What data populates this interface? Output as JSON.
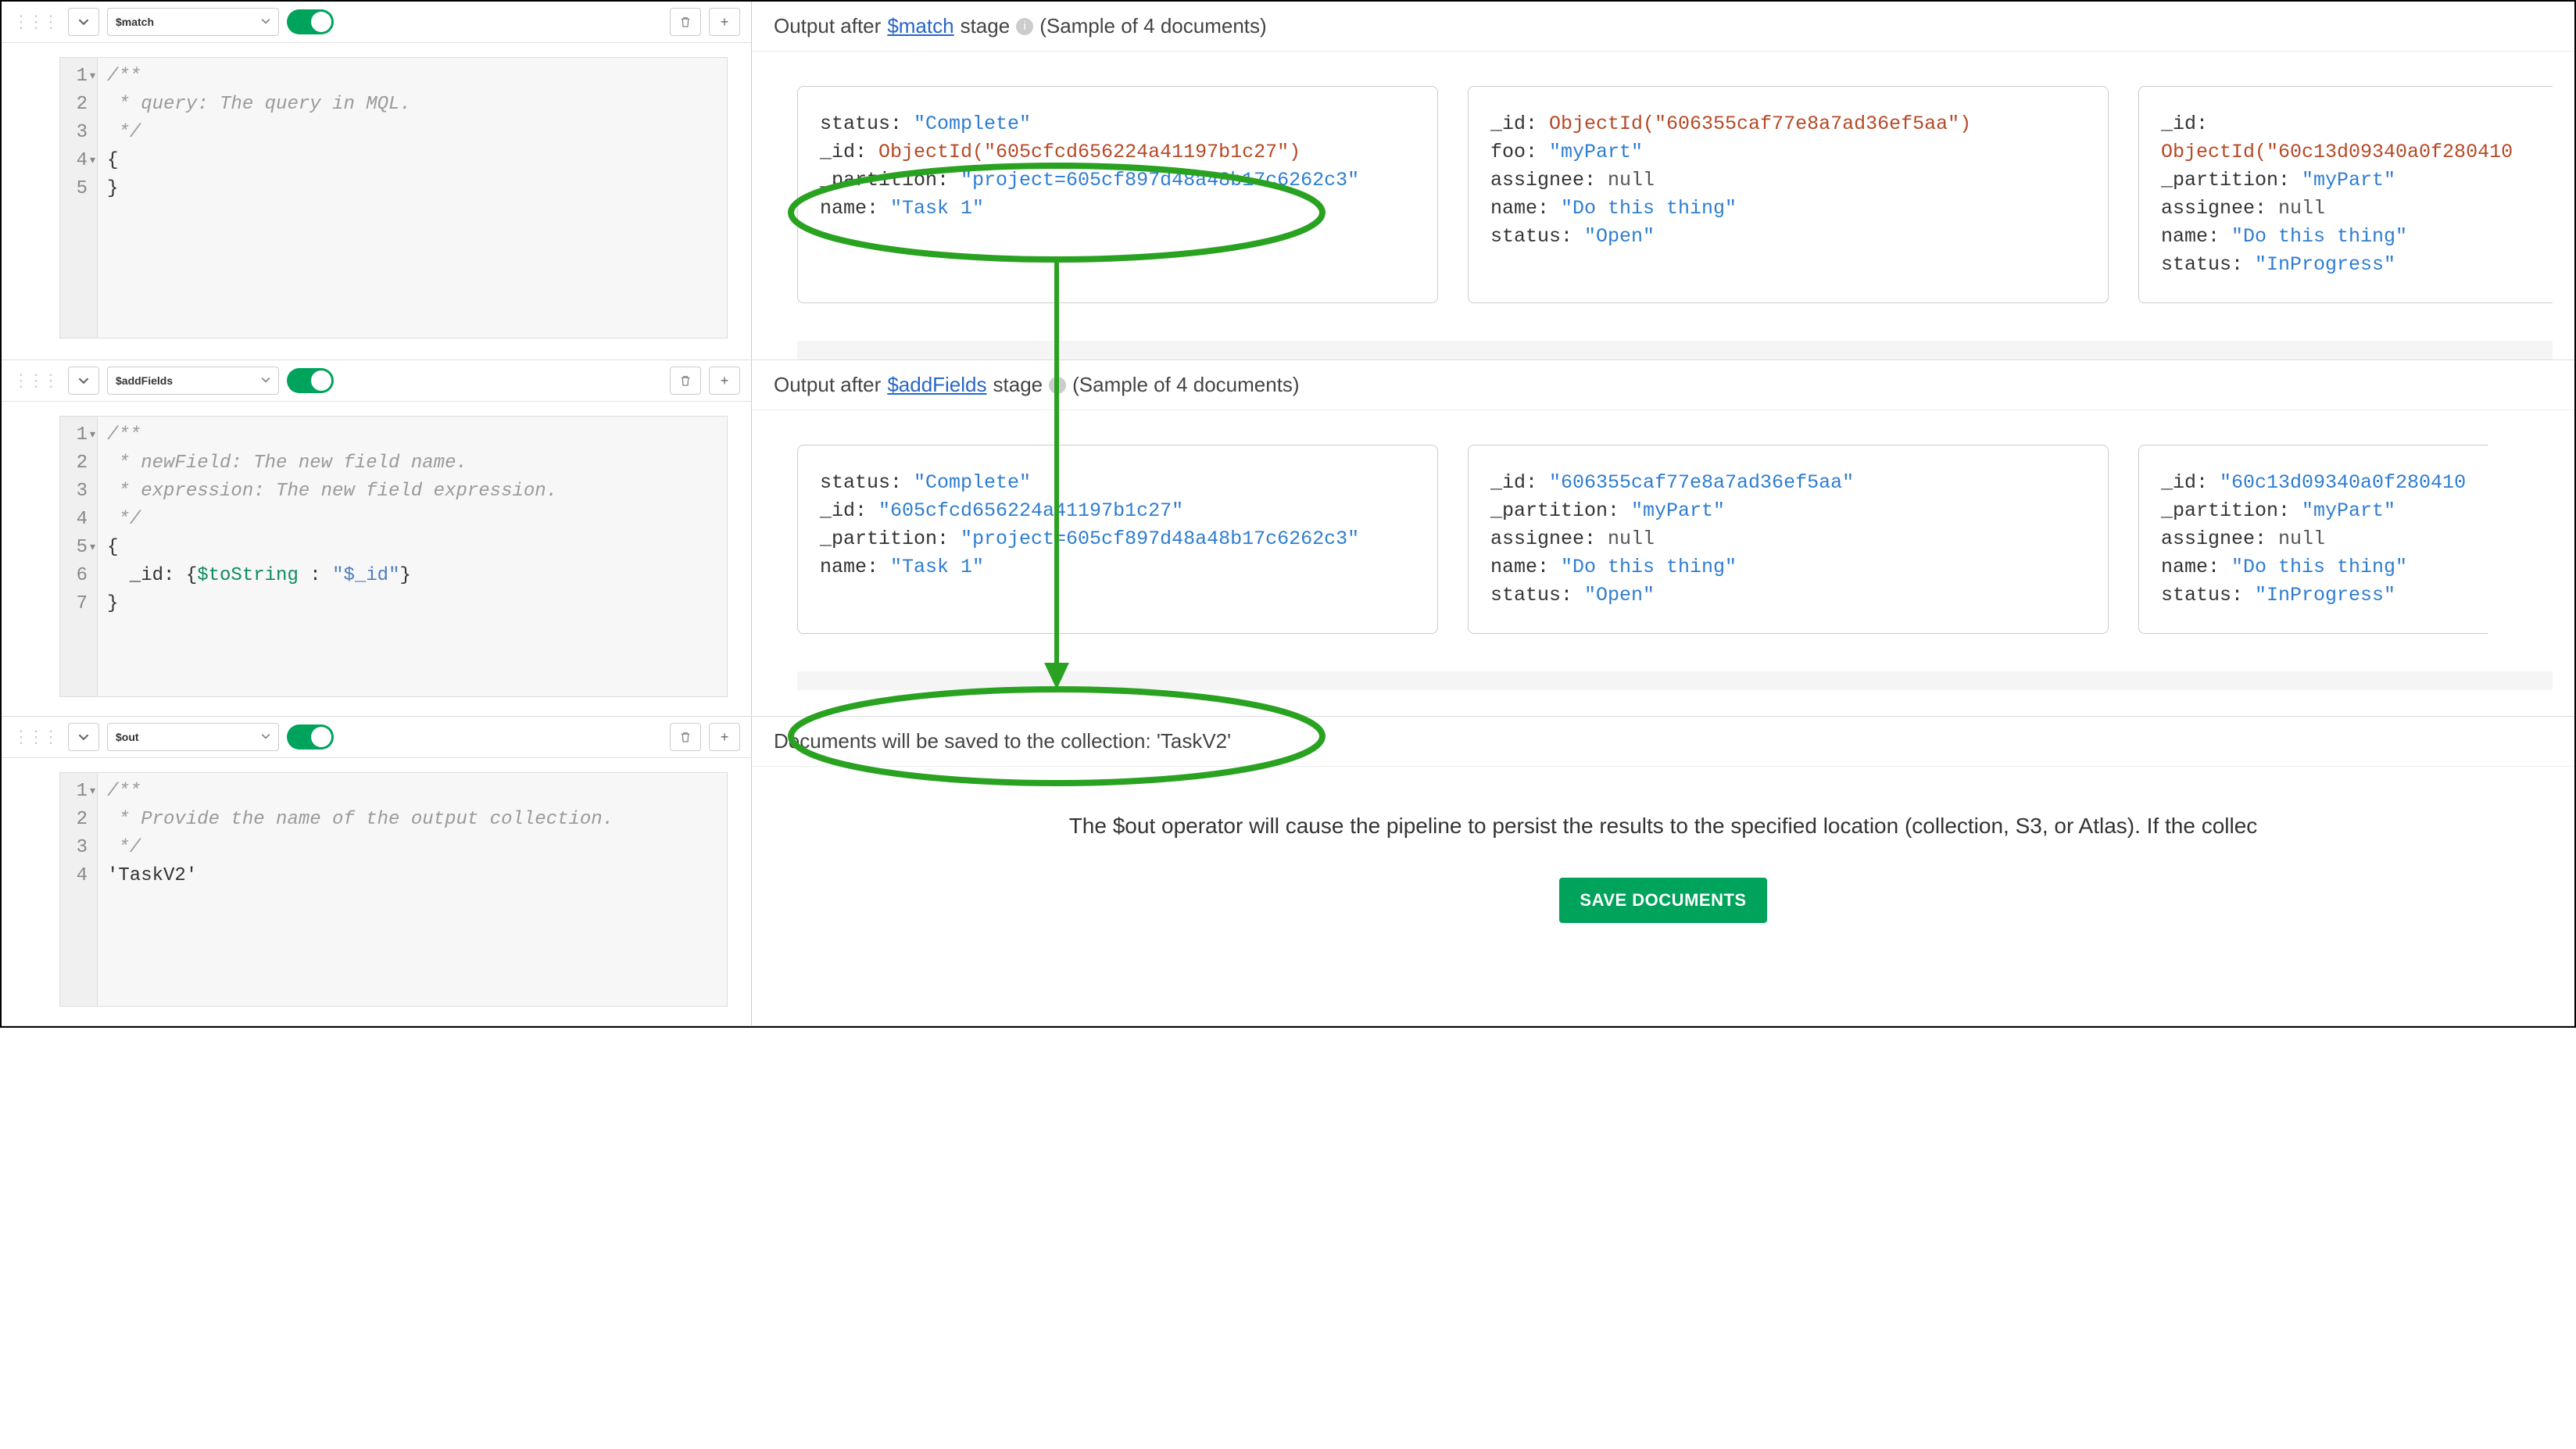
{
  "stages": [
    {
      "name": "$match",
      "code": {
        "lines": [
          {
            "n": "1",
            "fold": true,
            "txt": "/**"
          },
          {
            "n": "2",
            "txt": " * query: The query in MQL."
          },
          {
            "n": "3",
            "txt": " */"
          },
          {
            "n": "4",
            "fold": true,
            "plain": "{"
          },
          {
            "n": "5",
            "plain": "}"
          }
        ]
      },
      "output": {
        "prefix": "Output after ",
        "link": "$match",
        "suffix": " stage",
        "sample": "(Sample of 4 documents)"
      },
      "docs": [
        [
          {
            "k": "status",
            "v": "\"Complete\"",
            "t": "str"
          },
          {
            "k": "_id",
            "v": "ObjectId(\"605cfcd656224a41197b1c27\")",
            "t": "call"
          },
          {
            "k": "_partition",
            "v": "\"project=605cf897d48a48b17c6262c3\"",
            "t": "str"
          },
          {
            "k": "name",
            "v": "\"Task 1\"",
            "t": "str"
          }
        ],
        [
          {
            "k": "_id",
            "v": "ObjectId(\"606355caf77e8a7ad36ef5aa\")",
            "t": "call"
          },
          {
            "k": "foo",
            "v": "\"myPart\"",
            "t": "str"
          },
          {
            "k": "assignee",
            "v": "null",
            "t": "null"
          },
          {
            "k": "name",
            "v": "\"Do this thing\"",
            "t": "str"
          },
          {
            "k": "status",
            "v": "\"Open\"",
            "t": "str"
          }
        ],
        [
          {
            "k": "_id",
            "v": "ObjectId(\"60c13d09340a0f280410",
            "t": "call"
          },
          {
            "k": "_partition",
            "v": "\"myPart\"",
            "t": "str"
          },
          {
            "k": "assignee",
            "v": "null",
            "t": "null"
          },
          {
            "k": "name",
            "v": "\"Do this thing\"",
            "t": "str"
          },
          {
            "k": "status",
            "v": "\"InProgress\"",
            "t": "str"
          }
        ]
      ]
    },
    {
      "name": "$addFields",
      "code": {
        "lines": [
          {
            "n": "1",
            "fold": true,
            "txt": "/**"
          },
          {
            "n": "2",
            "txt": " * newField: The new field name."
          },
          {
            "n": "3",
            "txt": " * expression: The new field expression."
          },
          {
            "n": "4",
            "txt": " */"
          },
          {
            "n": "5",
            "fold": true,
            "plain": "{"
          },
          {
            "n": "6",
            "code": {
              "pre": "  _id: {",
              "op": "$toString",
              "mid": " : ",
              "str": "\"$_id\"",
              "post": "}"
            }
          },
          {
            "n": "7",
            "plain": "}"
          }
        ]
      },
      "output": {
        "prefix": "Output after ",
        "link": "$addFields",
        "suffix": " stage",
        "sample": "(Sample of 4 documents)"
      },
      "docs": [
        [
          {
            "k": "status",
            "v": "\"Complete\"",
            "t": "str"
          },
          {
            "k": "_id",
            "v": "\"605cfcd656224a41197b1c27\"",
            "t": "str"
          },
          {
            "k": "_partition",
            "v": "\"project=605cf897d48a48b17c6262c3\"",
            "t": "str"
          },
          {
            "k": "name",
            "v": "\"Task 1\"",
            "t": "str"
          }
        ],
        [
          {
            "k": "_id",
            "v": "\"606355caf77e8a7ad36ef5aa\"",
            "t": "str"
          },
          {
            "k": "_partition",
            "v": "\"myPart\"",
            "t": "str"
          },
          {
            "k": "assignee",
            "v": "null",
            "t": "null"
          },
          {
            "k": "name",
            "v": "\"Do this thing\"",
            "t": "str"
          },
          {
            "k": "status",
            "v": "\"Open\"",
            "t": "str"
          }
        ],
        [
          {
            "k": "_id",
            "v": "\"60c13d09340a0f280410",
            "t": "str"
          },
          {
            "k": "_partition",
            "v": "\"myPart\"",
            "t": "str"
          },
          {
            "k": "assignee",
            "v": "null",
            "t": "null"
          },
          {
            "k": "name",
            "v": "\"Do this thing\"",
            "t": "str"
          },
          {
            "k": "status",
            "v": "\"InProgress\"",
            "t": "str"
          }
        ]
      ]
    },
    {
      "name": "$out",
      "code": {
        "lines": [
          {
            "n": "1",
            "fold": true,
            "txt": "/**"
          },
          {
            "n": "2",
            "txt": " * Provide the name of the output collection."
          },
          {
            "n": "3",
            "txt": " */"
          },
          {
            "n": "4",
            "plain": "'TaskV2'"
          }
        ]
      },
      "outText": {
        "header": "Documents will be saved to the collection: 'TaskV2'",
        "desc": "The $out operator will cause the pipeline to persist the results to the specified location (collection, S3, or Atlas). If the collec",
        "button": "SAVE DOCUMENTS"
      }
    }
  ]
}
